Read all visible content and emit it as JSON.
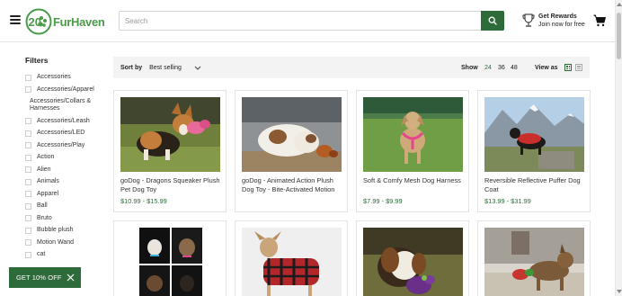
{
  "header": {
    "logo_number": "20",
    "logo_text": "FurHaven",
    "search_placeholder": "Search",
    "rewards_title": "Get Rewards",
    "rewards_subtitle": "Join now for free"
  },
  "filters": {
    "title": "Filters",
    "items": [
      {
        "label": "Accessories",
        "checkbox": true
      },
      {
        "label": "Accessories/Apparel",
        "checkbox": true
      },
      {
        "label": "Accessories/Collars & Harnesses",
        "checkbox": false
      },
      {
        "label": "Accessories/Leash",
        "checkbox": true
      },
      {
        "label": "Accessories/LED",
        "checkbox": true
      },
      {
        "label": "Accessories/Play",
        "checkbox": true
      },
      {
        "label": "Action",
        "checkbox": true
      },
      {
        "label": "Alien",
        "checkbox": true
      },
      {
        "label": "Animals",
        "checkbox": true
      },
      {
        "label": "Apparel",
        "checkbox": true
      },
      {
        "label": "Ball",
        "checkbox": true
      },
      {
        "label": "Bruto",
        "checkbox": true
      },
      {
        "label": "Bubble plush",
        "checkbox": true
      },
      {
        "label": "Motion Wand",
        "checkbox": true
      },
      {
        "label": "cat",
        "checkbox": true
      }
    ]
  },
  "sortbar": {
    "sort_label": "Sort by",
    "sort_value": "Best selling",
    "show_label": "Show",
    "show_options": [
      "24",
      "36",
      "48"
    ],
    "show_active": "24",
    "view_label": "View as"
  },
  "products": [
    {
      "title": "goDog - Dragons Squeaker Plush Pet Dog Toy",
      "price": "$10.99 - $15.99"
    },
    {
      "title": "goDog - Animated Action Plush Dog Toy - Bite-Activated Motion",
      "price": ""
    },
    {
      "title": "Soft & Comfy Mesh Dog Harness",
      "price": "$7.99 - $9.99"
    },
    {
      "title": "Reversible Reflective Puffer Dog Coat",
      "price": "$13.99 - $31.99"
    }
  ],
  "promo": {
    "label": "GET 10% OFF"
  },
  "colors": {
    "brand_green": "#2e6b3a",
    "logo_green": "#4a9a4a"
  }
}
